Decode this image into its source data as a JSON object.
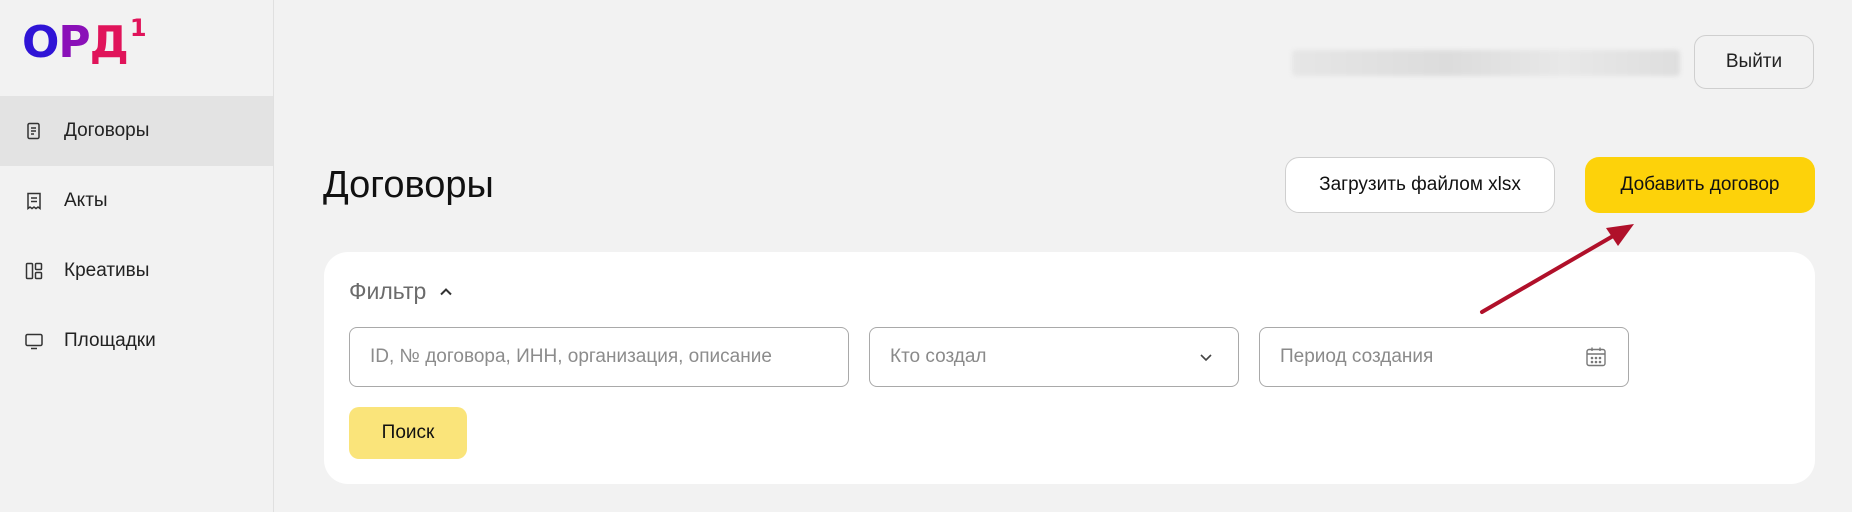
{
  "logo": {
    "part1": "О",
    "part2": "Р",
    "part3": "Д",
    "superscript": "1"
  },
  "sidebar": {
    "items": [
      {
        "label": "Договоры",
        "icon": "document-icon",
        "active": true
      },
      {
        "label": "Акты",
        "icon": "receipt-icon",
        "active": false
      },
      {
        "label": "Креативы",
        "icon": "grid-icon",
        "active": false
      },
      {
        "label": "Площадки",
        "icon": "monitor-icon",
        "active": false
      }
    ]
  },
  "header": {
    "logout_label": "Выйти"
  },
  "main": {
    "title": "Договоры",
    "upload_label": "Загрузить файлом xlsx",
    "add_label": "Добавить договор"
  },
  "filter": {
    "title": "Фильтр",
    "search_placeholder": "ID, № договора, ИНН, организация, описание",
    "creator_placeholder": "Кто создал",
    "period_placeholder": "Период создания",
    "search_button": "Поиск"
  },
  "colors": {
    "accent_yellow": "#fdd20a",
    "search_button_yellow": "#fae47a",
    "annotation_arrow": "#b0102a",
    "logo_blue": "#2f14d6",
    "logo_red": "#e0145a"
  }
}
